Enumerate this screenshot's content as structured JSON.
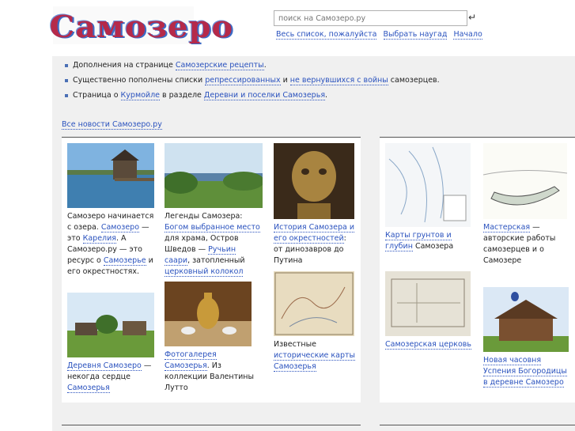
{
  "logo": {
    "text": "Самозеро"
  },
  "search": {
    "placeholder": "поиск на Самозеро.ру"
  },
  "header_links": [
    "Весь список, пожалуйста",
    "Выбрать наугад",
    "Начало"
  ],
  "news": [
    {
      "pre": "Дополнения на странице ",
      "links": [
        "Самозерские рецепты"
      ],
      "mid": [],
      "post": "."
    },
    {
      "pre": "Существенно пополнены списки ",
      "l1": "репрессированных",
      "m1": " и ",
      "l2": "не вернувшихся с войны",
      "post": " самозерцев."
    },
    {
      "pre": "Страница о ",
      "l1": "Курмойле",
      "m1": " в разделе ",
      "l2": "Деревни и поселки Самозерья",
      "post": "."
    }
  ],
  "all_news": "Все новости Самозеро.ру",
  "cards": {
    "c1": {
      "t1": "Самозеро начинается с озера. ",
      "l1": "Самозеро",
      "t2": " — это ",
      "l2": "Карелия",
      "t3": ". А Самозеро.ру — это ресурс о ",
      "l3": "Самозерье",
      "t4": " и его окрестностях."
    },
    "c2": {
      "t1": "Легенды Самозера: ",
      "l1": "Богом выбранное место",
      "t2": " для храма, Остров Шведов — ",
      "l2": "Ручьин саари",
      "t3": ", затопленный ",
      "l3": "церковный колокол"
    },
    "c3": {
      "l1": "История Самозера и его окрестностей",
      "t1": ": от динозавров до Путина"
    },
    "c4": {
      "l1": "Деревня Самозеро",
      "t1": " — некогда сердце ",
      "l2": "Самозерья"
    },
    "c5": {
      "l1": "Фотогалерея Самозерья",
      "t1": ". Из коллекции Валентины Лутто"
    },
    "c6": {
      "t1": "Известные ",
      "l1": "исторические карты Самозерья"
    },
    "c7": {
      "l1": "Карты грунтов и глубин",
      "t1": " Самозера"
    },
    "c8": {
      "l1": "Мастерская",
      "t1": " — авторские работы самозерцев и о Самозере"
    },
    "c9": {
      "l1": "Самозерская церковь"
    },
    "c10": {
      "l1": "Новая часовня Успения Богородицы в деревне Самозеро"
    }
  },
  "colors": {
    "link": "#2a52be",
    "main_bg": "#f0f0f0",
    "logo_red": "#b52a4a",
    "logo_blue": "#3a6cc8"
  }
}
